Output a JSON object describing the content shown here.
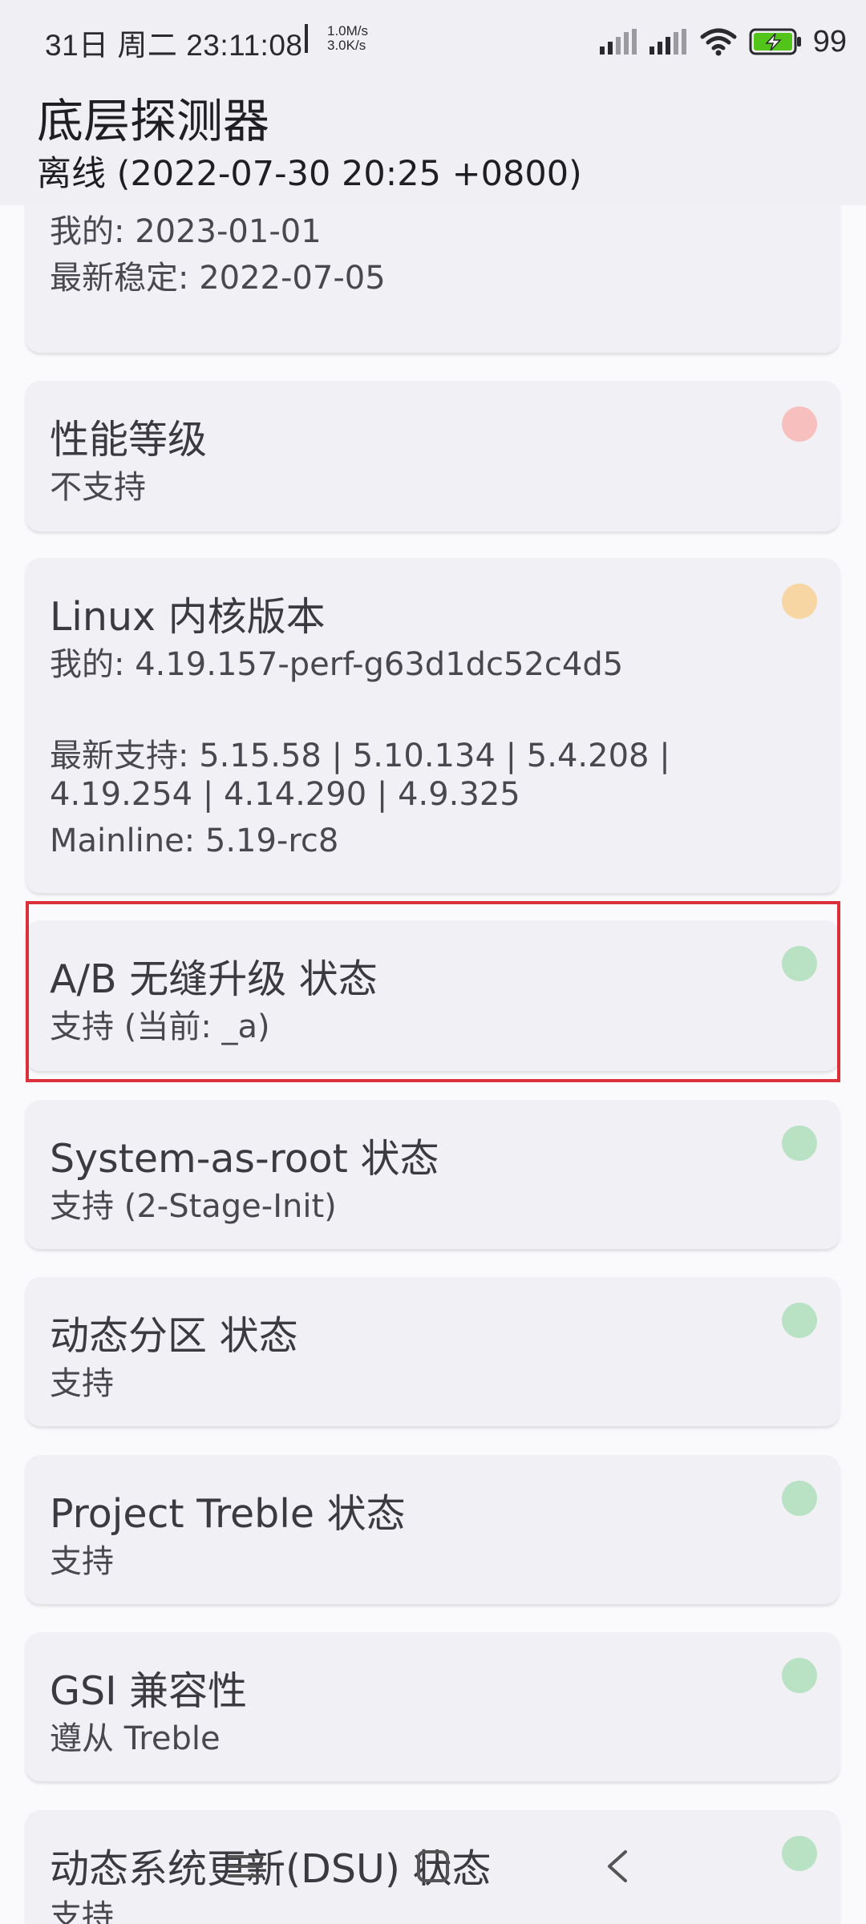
{
  "status_bar": {
    "time": "31日 周二 23:11:08",
    "net_up": "1.0M/s",
    "net_down": "3.0K/s",
    "battery": "99"
  },
  "app_bar": {
    "title": "底层探测器",
    "subtitle": "离线 (2022-07-30 20:25 +0800)"
  },
  "cards": {
    "security_patch": {
      "mine": "我的: 2023-01-01",
      "latest": "最新稳定: 2022-07-05"
    },
    "perf_level": {
      "title": "性能等级",
      "value": "不支持",
      "status_color": "#f8bfbf"
    },
    "kernel": {
      "title": "Linux 内核版本",
      "mine": "我的: 4.19.157-perf-g63d1dc52c4d5",
      "latest_line1": "最新支持: 5.15.58 | 5.10.134 | 5.4.208 |",
      "latest_line2": "4.19.254 | 4.14.290 | 4.9.325",
      "mainline": "Mainline: 5.19-rc8",
      "status_color": "#f7d6a3"
    },
    "ab": {
      "title": "A/B 无缝升级 状态",
      "value": "支持 (当前: _a)",
      "status_color": "#b9e1c4"
    },
    "sar": {
      "title": "System-as-root 状态",
      "value": "支持 (2-Stage-Init)",
      "status_color": "#b9e1c4"
    },
    "dynamic_partitions": {
      "title": "动态分区 状态",
      "value": "支持",
      "status_color": "#b9e1c4"
    },
    "treble": {
      "title": "Project Treble 状态",
      "value": "支持",
      "status_color": "#b9e1c4"
    },
    "gsi": {
      "title": "GSI 兼容性",
      "value": "遵从 Treble",
      "status_color": "#b9e1c4"
    },
    "dsu": {
      "title": "动态系统更新(DSU) 状态",
      "value": "支持",
      "status_color": "#b9e1c4"
    }
  },
  "icons": {
    "signal1": "cell-signal-icon",
    "signal2": "cell-signal-icon",
    "wifi": "wifi-icon",
    "battery": "battery-charging-icon",
    "nav_menu": "menu-icon",
    "nav_home": "home-icon",
    "nav_back": "back-icon"
  }
}
